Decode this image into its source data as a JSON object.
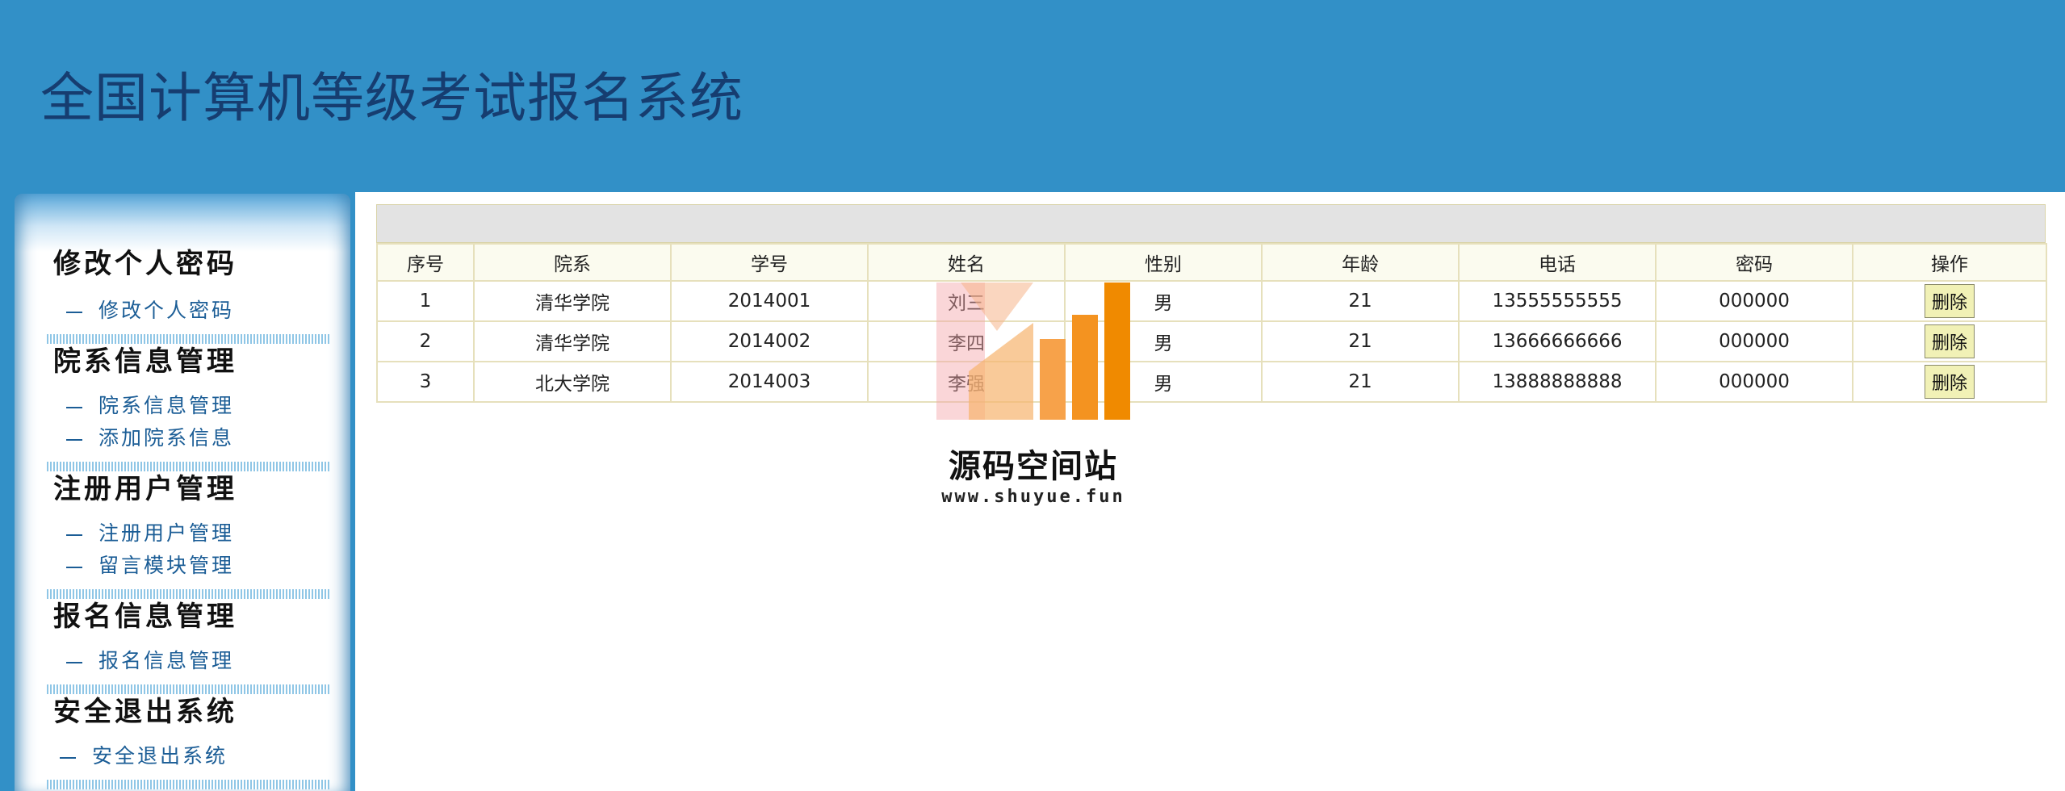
{
  "header": {
    "title": "全国计算机等级考试报名系统",
    "background": "#3290c7"
  },
  "sidebar": {
    "groups": [
      {
        "title": "修改个人密码",
        "items": [
          "修改个人密码"
        ]
      },
      {
        "title": "院系信息管理",
        "items": [
          "院系信息管理",
          "添加院系信息"
        ]
      },
      {
        "title": "注册用户管理",
        "items": [
          "注册用户管理",
          "留言模块管理"
        ]
      },
      {
        "title": "报名信息管理",
        "items": [
          "报名信息管理"
        ]
      },
      {
        "title": "安全退出系统",
        "items": [
          "安全退出系统"
        ]
      }
    ]
  },
  "table": {
    "columns": [
      "序号",
      "院系",
      "学号",
      "姓名",
      "性别",
      "年龄",
      "电话",
      "密码",
      "操作"
    ],
    "rows": [
      {
        "index": "1",
        "dept": "清华学院",
        "student_id": "2014001",
        "name": "刘三",
        "gender": "男",
        "age": "21",
        "phone": "13555555555",
        "password": "000000",
        "action": "删除"
      },
      {
        "index": "2",
        "dept": "清华学院",
        "student_id": "2014002",
        "name": "李四",
        "gender": "男",
        "age": "21",
        "phone": "13666666666",
        "password": "000000",
        "action": "删除"
      },
      {
        "index": "3",
        "dept": "北大学院",
        "student_id": "2014003",
        "name": "李强",
        "gender": "男",
        "age": "21",
        "phone": "13888888888",
        "password": "000000",
        "action": "删除"
      }
    ]
  },
  "watermark": {
    "name": "源码空间站",
    "url": "www.shuyue.fun",
    "colors": [
      "#f3a4a8",
      "#f7b36d",
      "#f49320",
      "#f08a00"
    ]
  }
}
